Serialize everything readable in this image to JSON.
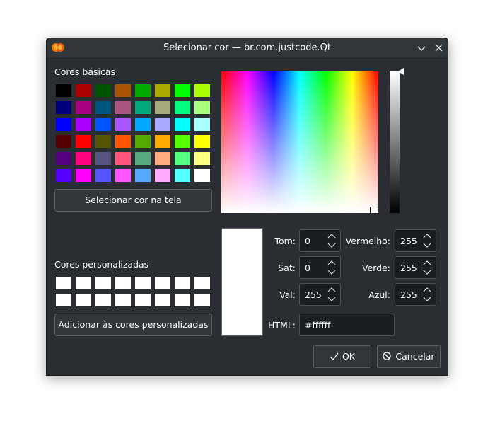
{
  "window": {
    "title": "Selecionar cor — br.com.justcode.Qt",
    "minimize_glyph": "⌄",
    "close_glyph": "✕"
  },
  "basic_colors": {
    "label": "Cores básicas",
    "rows": [
      [
        "#000000",
        "#aa0000",
        "#005500",
        "#aa5500",
        "#00aa00",
        "#aaaa00",
        "#00ff00",
        "#aaff00"
      ],
      [
        "#00007f",
        "#aa007f",
        "#00557f",
        "#aa557f",
        "#00aa7f",
        "#aaaa7f",
        "#00ff7f",
        "#aaff7f"
      ],
      [
        "#0000ff",
        "#aa00ff",
        "#0055ff",
        "#aa55ff",
        "#00aaff",
        "#aaaaff",
        "#00ffff",
        "#aaffff"
      ],
      [
        "#550000",
        "#ff0000",
        "#555500",
        "#ff5500",
        "#55aa00",
        "#ffaa00",
        "#55ff00",
        "#ffff00"
      ],
      [
        "#55007f",
        "#ff007f",
        "#55557f",
        "#ff557f",
        "#55aa7f",
        "#ffaa7f",
        "#55ff7f",
        "#ffff7f"
      ],
      [
        "#5500ff",
        "#ff00ff",
        "#5555ff",
        "#ff55ff",
        "#55aaff",
        "#ffaaff",
        "#55ffff",
        "#ffffff"
      ]
    ]
  },
  "pick_screen_button": "Selecionar cor na tela",
  "custom_colors": {
    "label": "Cores personalizadas",
    "rows": [
      [
        "#ffffff",
        "#ffffff",
        "#ffffff",
        "#ffffff",
        "#ffffff",
        "#ffffff",
        "#ffffff",
        "#ffffff"
      ],
      [
        "#ffffff",
        "#ffffff",
        "#ffffff",
        "#ffffff",
        "#ffffff",
        "#ffffff",
        "#ffffff",
        "#ffffff"
      ]
    ]
  },
  "add_custom_button": "Adicionar às cores personalizadas",
  "preview_color": "#ffffff",
  "fields": {
    "hue_label": "Tom:",
    "hue": "0",
    "sat_label": "Sat:",
    "sat": "0",
    "val_label": "Val:",
    "val": "255",
    "red_label": "Vermelho:",
    "red": "255",
    "green_label": "Verde:",
    "green": "255",
    "blue_label": "Azul:",
    "blue": "255",
    "html_label": "HTML:",
    "html": "#ffffff"
  },
  "buttons": {
    "ok": "OK",
    "cancel": "Cancelar"
  }
}
